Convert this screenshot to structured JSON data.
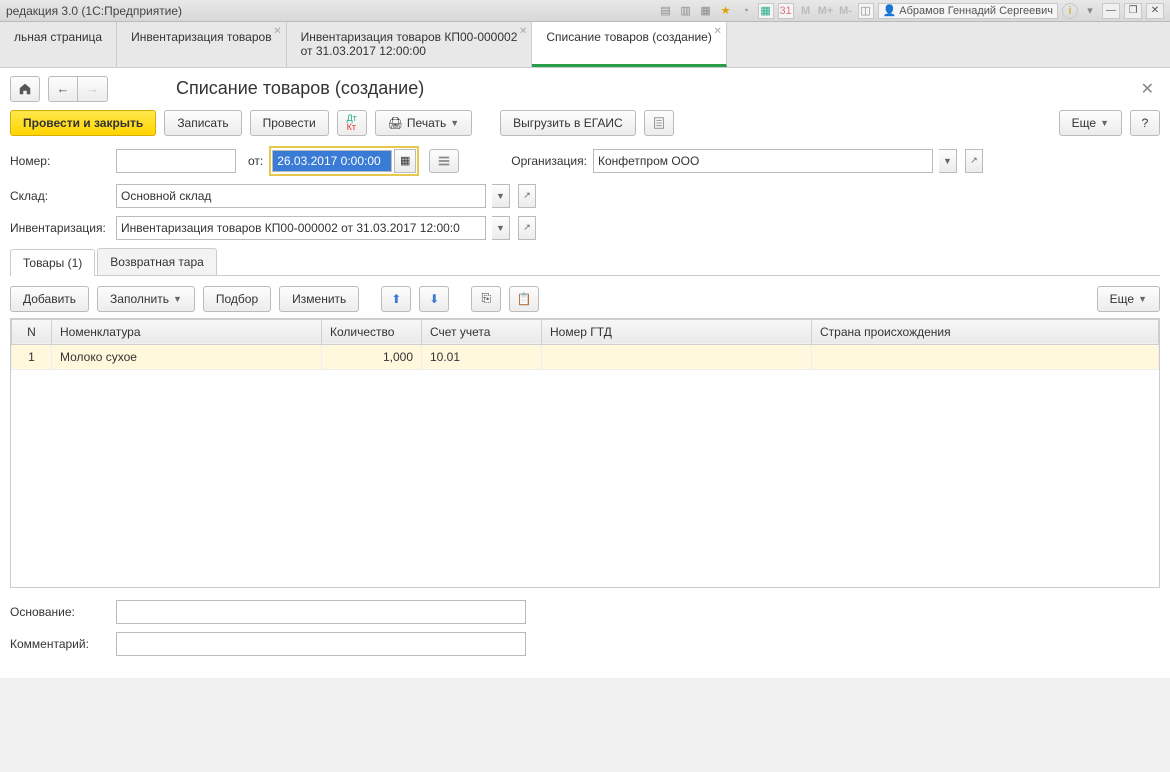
{
  "titlebar": {
    "title": "редакция 3.0  (1С:Предприятие)",
    "user": "Абрамов Геннадий Сергеевич",
    "m_labels": [
      "M",
      "M+",
      "M-"
    ]
  },
  "tabs": [
    {
      "label": "льная страница"
    },
    {
      "label": "Инвентаризация товаров"
    },
    {
      "label_line1": "Инвентаризация товаров КП00-000002",
      "label_line2": "от 31.03.2017 12:00:00"
    },
    {
      "label": "Списание товаров (создание)"
    }
  ],
  "page": {
    "title": "Списание товаров (создание)"
  },
  "toolbar": {
    "post_close": "Провести и закрыть",
    "record": "Записать",
    "post": "Провести",
    "print": "Печать",
    "egais": "Выгрузить в ЕГАИС",
    "more": "Еще",
    "help": "?"
  },
  "form": {
    "number_label": "Номер:",
    "number_value": "",
    "from_label": "от:",
    "date_value": "26.03.2017  0:00:00",
    "org_label": "Организация:",
    "org_value": "Конфетпром ООО",
    "warehouse_label": "Склад:",
    "warehouse_value": "Основной склад",
    "inventory_label": "Инвентаризация:",
    "inventory_value": "Инвентаризация товаров КП00-000002 от 31.03.2017 12:00:0",
    "basis_label": "Основание:",
    "basis_value": "",
    "comment_label": "Комментарий:",
    "comment_value": ""
  },
  "subtabs": {
    "goods": "Товары (1)",
    "tare": "Возвратная тара"
  },
  "gridtoolbar": {
    "add": "Добавить",
    "fill": "Заполнить",
    "select": "Подбор",
    "change": "Изменить",
    "more": "Еще"
  },
  "grid": {
    "col_n": "N",
    "col_nom": "Номенклатура",
    "col_qty": "Количество",
    "col_acc": "Счет учета",
    "col_gtd": "Номер ГТД",
    "col_country": "Страна происхождения",
    "rows": [
      {
        "n": "1",
        "nom": "Молоко сухое",
        "qty": "1,000",
        "acc": "10.01",
        "gtd": "",
        "country": ""
      }
    ]
  }
}
